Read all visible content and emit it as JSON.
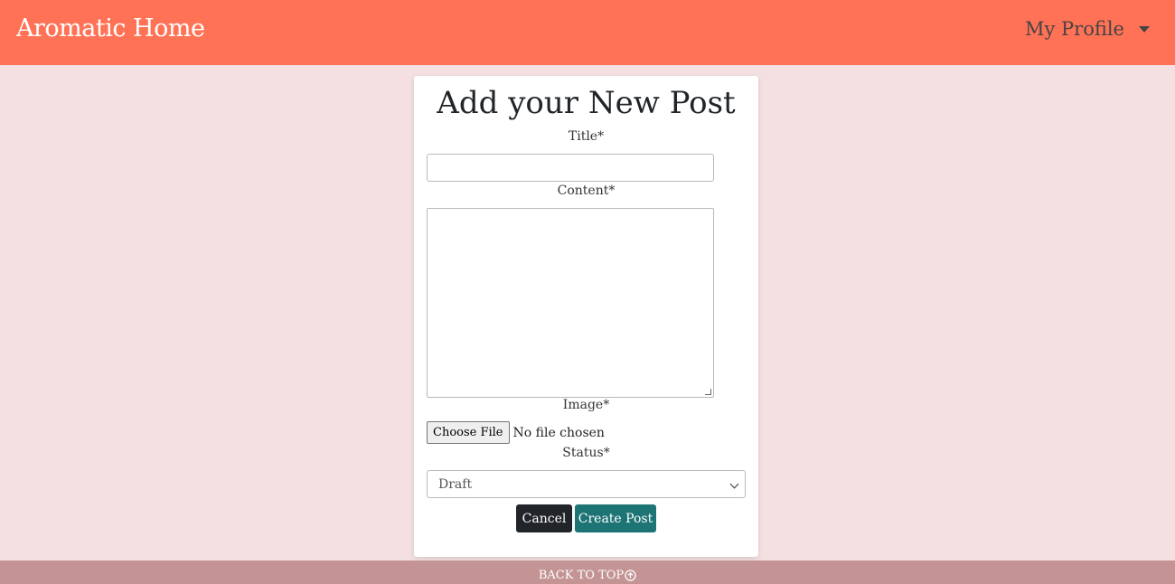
{
  "navbar": {
    "brand": "Aromatic Home",
    "profile_label": "My Profile",
    "profile_icon": "caret-down-icon"
  },
  "form": {
    "heading": "Add your New Post",
    "title_label": "Title*",
    "title_value": "",
    "content_label": "Content*",
    "content_value": "",
    "image_label": "Image*",
    "file_button": "Choose File",
    "file_status": "No file chosen",
    "status_label": "Status*",
    "status_value": "Draft",
    "cancel_label": "Cancel",
    "create_label": "Create Post"
  },
  "footer": {
    "back_to_top": "BACK TO TOP",
    "back_to_top_icon": "arrow-up-circle-icon"
  },
  "colors": {
    "navbar": "#ff7256",
    "background": "#f4e0e0",
    "create_button": "#1d7474",
    "cancel_button": "#212529",
    "footer": "#c49494"
  }
}
